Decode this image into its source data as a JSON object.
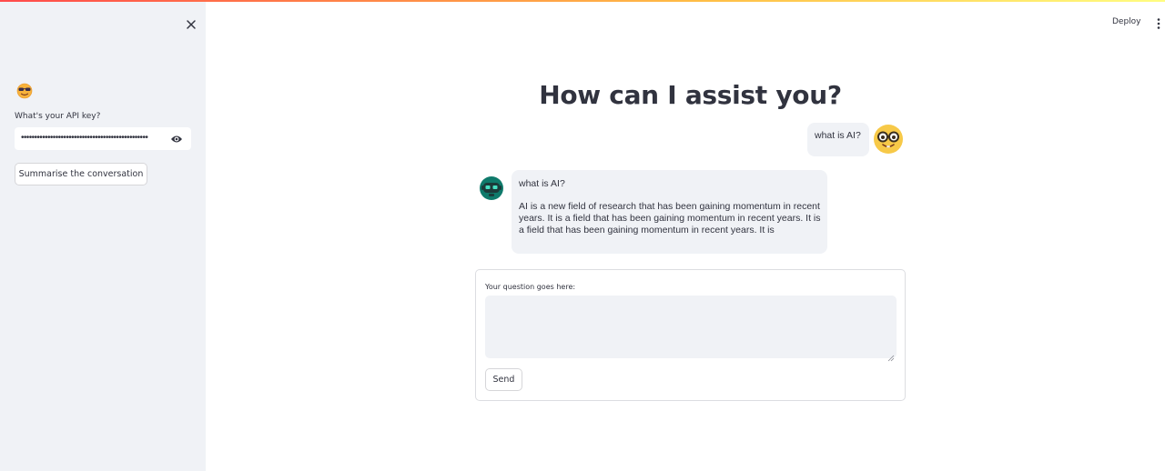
{
  "sidebar": {
    "close_icon": "close-icon",
    "emoji_icon": "sunglasses-face-icon",
    "api_key_label": "What's your API key?",
    "api_key_value": "••••••••••••••••••••••••••••••••••••••••••••••••",
    "eye_icon": "eye-icon",
    "summarise_label": "Summarise the conversation"
  },
  "header": {
    "deploy_label": "Deploy",
    "menu_icon": "vertical-dots-icon"
  },
  "main": {
    "title": "How can I assist you?",
    "messages": [
      {
        "role": "user",
        "avatar": "nerd-face-icon",
        "text": "what is AI?"
      },
      {
        "role": "assistant",
        "avatar": "robot-icon",
        "title": "what is AI?",
        "text": "AI is a new field of research that has been gaining momentum in recent years. It is a field that has been gaining momentum in recent years. It is a field that has been gaining momentum in recent years. It is"
      }
    ],
    "form": {
      "question_label": "Your question goes here:",
      "question_value": "",
      "send_label": "Send"
    }
  },
  "colors": {
    "sidebar_bg": "#f0f2f6",
    "accent_red": "#ff4b4b",
    "text": "#31333f"
  }
}
